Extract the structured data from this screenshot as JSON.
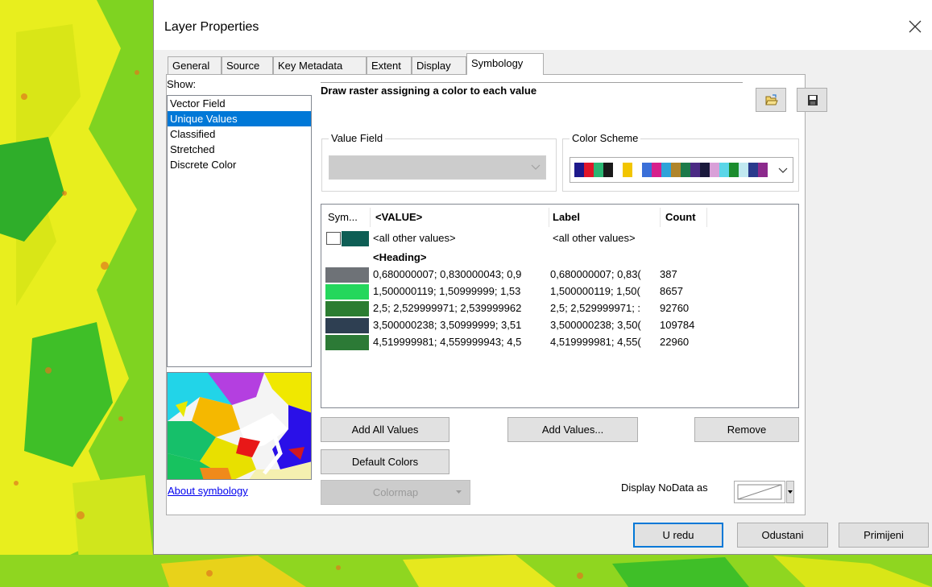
{
  "dialog": {
    "title": "Layer Properties",
    "tabs": [
      {
        "label": "General"
      },
      {
        "label": "Source"
      },
      {
        "label": "Key Metadata"
      },
      {
        "label": "Extent"
      },
      {
        "label": "Display"
      },
      {
        "label": "Symbology",
        "active": true
      }
    ]
  },
  "show": {
    "label": "Show:",
    "items": [
      {
        "label": "Vector Field"
      },
      {
        "label": "Unique Values",
        "selected": true
      },
      {
        "label": "Classified"
      },
      {
        "label": "Stretched"
      },
      {
        "label": "Discrete Color"
      }
    ],
    "about_link": "About symbology"
  },
  "description": "Draw raster assigning a color to each value",
  "value_field": {
    "label": "Value Field",
    "value": ""
  },
  "color_scheme": {
    "label": "Color Scheme",
    "colors": [
      "#1e1a8c",
      "#e0162a",
      "#2bb673",
      "#1a1a1a",
      "#ffffff",
      "#f2c500",
      "#ffffff",
      "#3a6fd8",
      "#d61f8c",
      "#2fa3d9",
      "#b0852a",
      "#1c7a4a",
      "#4b2a84",
      "#1a1a3c",
      "#d9a0d8",
      "#5ad6e8",
      "#1b8c2e",
      "#c0e8f0",
      "#2a3a8c",
      "#8c2a8c"
    ]
  },
  "table": {
    "headers": {
      "sym": "Sym...",
      "value": "<VALUE>",
      "label": "Label",
      "count": "Count"
    },
    "other": {
      "value": "<all other values>",
      "label": "<all other values>",
      "color": "#0e5e55"
    },
    "heading": "<Heading>",
    "rows": [
      {
        "color": "#6e7277",
        "value": "0,680000007; 0,830000043; 0,9",
        "label": "0,680000007; 0,83(",
        "count": "387"
      },
      {
        "color": "#24d75c",
        "value": "1,500000119; 1,50999999; 1,53",
        "label": "1,500000119; 1,50(",
        "count": "8657"
      },
      {
        "color": "#2b7d31",
        "value": "2,5; 2,529999971; 2,539999962",
        "label": "2,5; 2,529999971; :",
        "count": "92760"
      },
      {
        "color": "#2e3f52",
        "value": "3,500000238; 3,50999999; 3,51",
        "label": "3,500000238; 3,50(",
        "count": "109784"
      },
      {
        "color": "#2c7a36",
        "value": "4,519999981; 4,559999943; 4,5",
        "label": "4,519999981; 4,55(",
        "count": "22960"
      }
    ]
  },
  "buttons": {
    "add_all_values": "Add All Values",
    "add_values": "Add Values...",
    "remove": "Remove",
    "default_colors": "Default Colors",
    "colormap": "Colormap",
    "nodata_label": "Display NoData as",
    "ok": "U redu",
    "cancel": "Odustani",
    "apply": "Primijeni"
  }
}
